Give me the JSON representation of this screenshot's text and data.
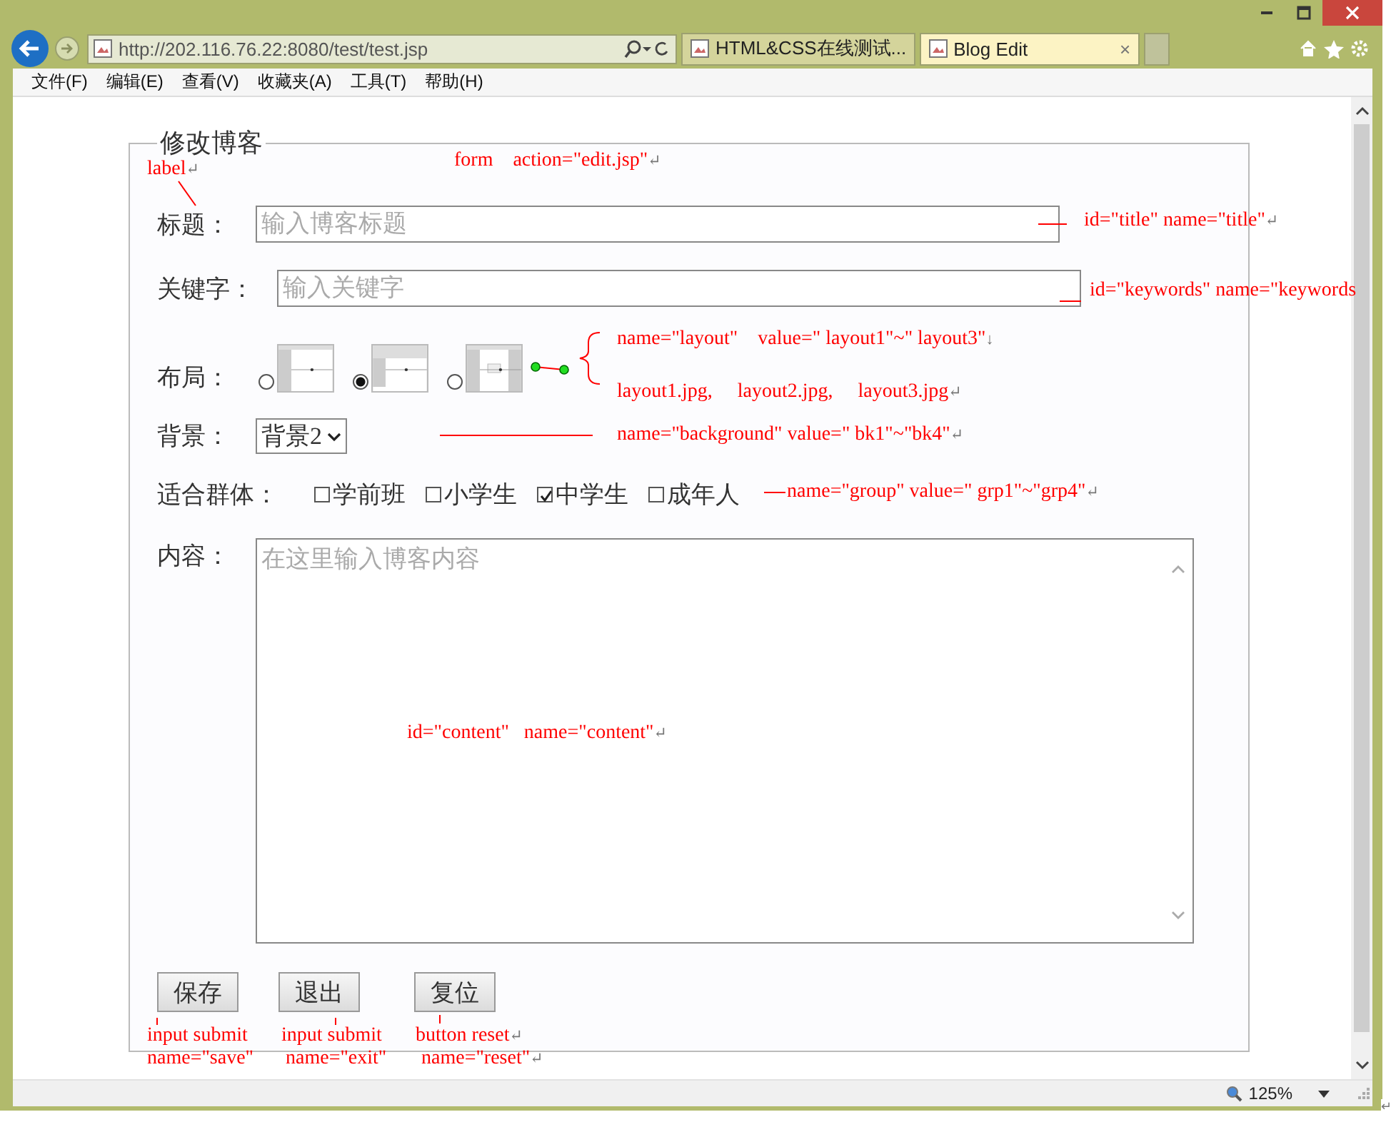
{
  "browser": {
    "address": "http://202.116.76.22:8080/test/test.jsp",
    "tabs": [
      {
        "title": "HTML&CSS在线测试...",
        "selected": false
      },
      {
        "title": "Blog Edit",
        "selected": true,
        "close": "×"
      }
    ],
    "menu": [
      "文件(F)",
      "编辑(E)",
      "查看(V)",
      "收藏夹(A)",
      "工具(T)",
      "帮助(H)"
    ],
    "zoom": "125%"
  },
  "form": {
    "legend": "修改博客",
    "title": {
      "label": "标题：",
      "placeholder": "输入博客标题"
    },
    "keywords": {
      "label": "关键字：",
      "placeholder": "输入关键字"
    },
    "layout": {
      "label": "布局：",
      "options": [
        {
          "selected": false
        },
        {
          "selected": true
        },
        {
          "selected": false
        }
      ]
    },
    "background": {
      "label": "背景：",
      "value": "背景2"
    },
    "group": {
      "label": "适合群体：",
      "options": [
        {
          "label": "学前班",
          "checked": false
        },
        {
          "label": "小学生",
          "checked": false
        },
        {
          "label": "中学生",
          "checked": true
        },
        {
          "label": "成年人",
          "checked": false
        }
      ]
    },
    "content": {
      "label": "内容：",
      "placeholder": "在这里输入博客内容"
    },
    "buttons": [
      "保存",
      "退出",
      "复位"
    ]
  },
  "annotations": [
    {
      "text": "label",
      "mark": "↵"
    },
    {
      "text": "form    action=\"edit.jsp\"",
      "mark": "↵"
    },
    {
      "text": "id=\"title\" name=\"title\"",
      "mark": "↵"
    },
    {
      "text": "id=\"keywords\" name=\"keywords"
    },
    {
      "text": "name=\"layout\"    value=\" layout1\"~\" layout3\"",
      "mark": "↓"
    },
    {
      "text": "layout1.jpg,     layout2.jpg,     layout3.jpg",
      "mark": "↵"
    },
    {
      "text": "name=\"background\" value=\" bk1\"~\"bk4\"",
      "mark": "↵"
    },
    {
      "text": "name=\"group\" value=\" grp1\"~\"grp4\"",
      "mark": "↵"
    },
    {
      "text": "id=\"content\"   name=\"content\"",
      "mark": "↵"
    },
    {
      "text": "input submit"
    },
    {
      "text": "name=\"save\""
    },
    {
      "text": "input submit"
    },
    {
      "text": "name=\"exit\""
    },
    {
      "text": "button reset",
      "mark": "↵"
    },
    {
      "text": "name=\"reset\"",
      "mark": "↵"
    }
  ],
  "end_mark": "↵"
}
